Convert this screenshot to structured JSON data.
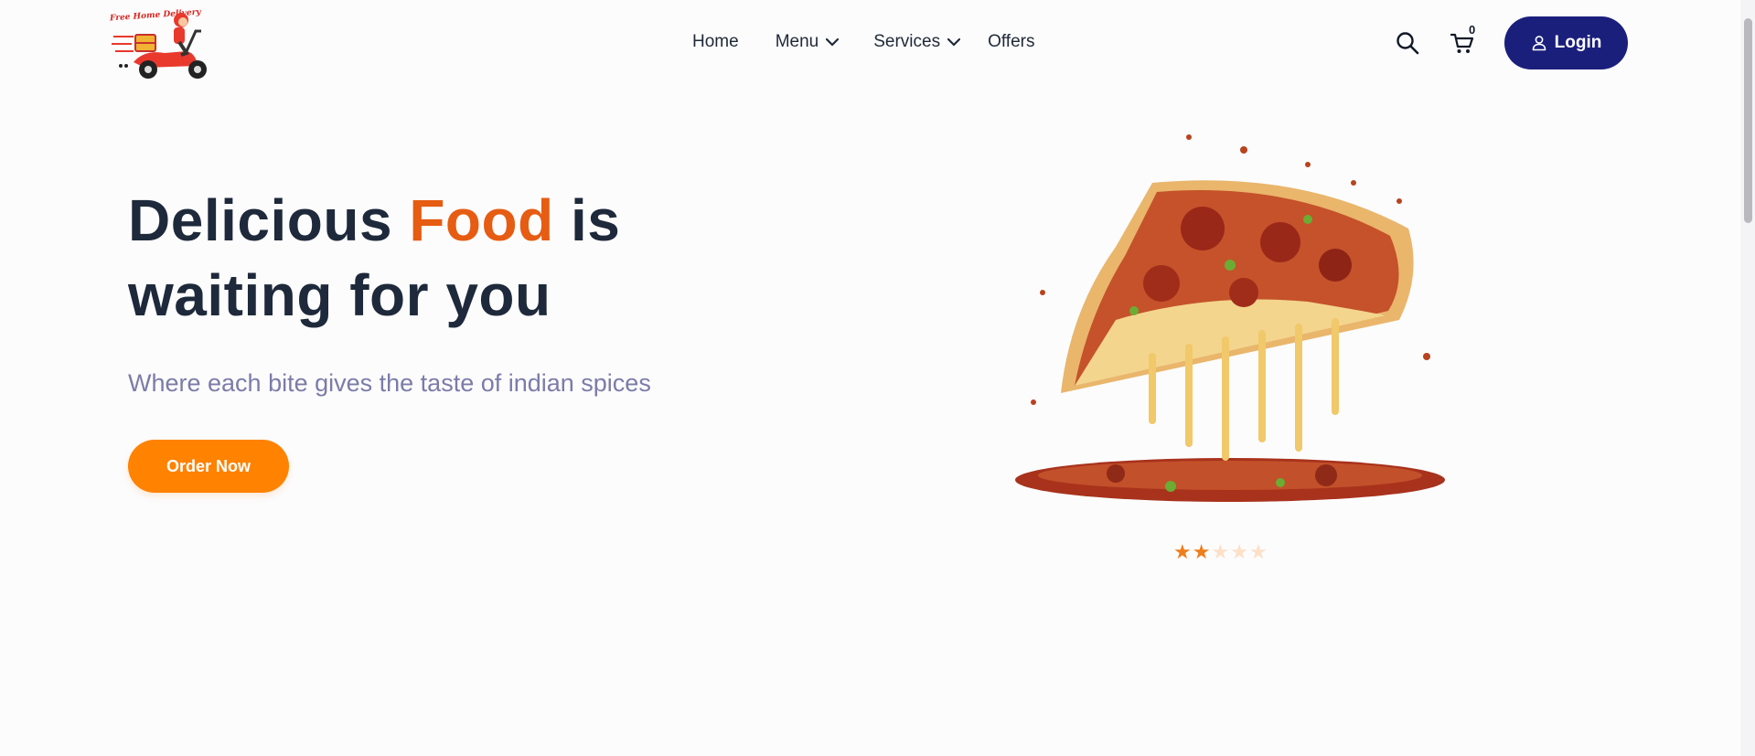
{
  "logo": {
    "text": "Free Home Delivery",
    "icon": "delivery-scooter-logo"
  },
  "nav": {
    "home": "Home",
    "menu": "Menu",
    "services": "Services",
    "offers": "Offers"
  },
  "header_actions": {
    "search_icon": "search-icon",
    "cart_icon": "cart-icon",
    "cart_count": "0",
    "login_label": "Login",
    "login_icon": "user-icon"
  },
  "hero": {
    "title_part1": "Delicious ",
    "title_accent": "Food",
    "title_part2": " is waiting for you",
    "subtitle": "Where each bite gives the taste of indian spices",
    "cta_label": "Order Now",
    "image": "pizza-slice"
  },
  "rating": {
    "value": 2,
    "max": 5
  },
  "colors": {
    "accent": "#e65c12",
    "cta": "#ff8200",
    "login": "#1a1f7c",
    "text": "#1e293b",
    "subtitle": "#7b7ca8",
    "star_filled": "#ef7d1a",
    "star_empty": "#fde0c8"
  }
}
